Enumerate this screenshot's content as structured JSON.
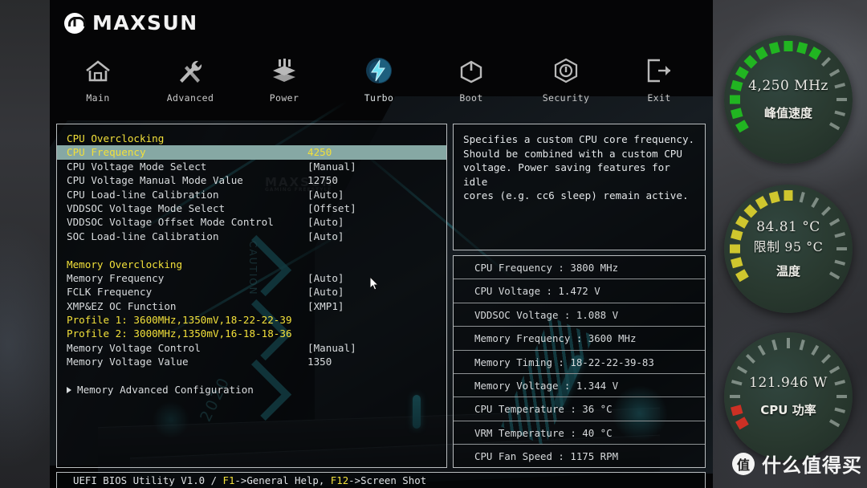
{
  "brand": {
    "name": "MAXSUN",
    "logo_icon": "maxsun-logo-icon"
  },
  "nav": {
    "tabs": [
      {
        "label": "Main",
        "icon": "home-icon",
        "active": false
      },
      {
        "label": "Advanced",
        "icon": "tools-icon",
        "active": false
      },
      {
        "label": "Power",
        "icon": "power-stack-icon",
        "active": false
      },
      {
        "label": "Turbo",
        "icon": "lightning-icon",
        "active": true
      },
      {
        "label": "Boot",
        "icon": "power-icon",
        "active": false
      },
      {
        "label": "Security",
        "icon": "shield-lock-icon",
        "active": false
      },
      {
        "label": "Exit",
        "icon": "exit-icon",
        "active": false
      }
    ]
  },
  "settings": {
    "groups": [
      {
        "header": "CPU Overclocking",
        "rows": [
          {
            "label": "CPU Frequency",
            "value": "4250",
            "selected": true
          },
          {
            "label": "CPU Voltage Mode Select",
            "value": "[Manual]",
            "selected": false
          },
          {
            "label": "CPU Voltage Manual Mode Value",
            "value": "12750",
            "selected": false
          },
          {
            "label": "CPU Load-line Calibration",
            "value": "[Auto]",
            "selected": false
          },
          {
            "label": "VDDSOC Voltage Mode Select",
            "value": "[Offset]",
            "selected": false
          },
          {
            "label": "VDDSOC Voltage Offset Mode Control",
            "value": "[Auto]",
            "selected": false
          },
          {
            "label": "SOC Load-line Calibration",
            "value": "[Auto]",
            "selected": false
          }
        ]
      },
      {
        "header": "Memory Overclocking",
        "rows": [
          {
            "label": "Memory Frequency",
            "value": "[Auto]",
            "selected": false
          },
          {
            "label": "FCLK Frequency",
            "value": "[Auto]",
            "selected": false
          },
          {
            "label": "XMP&EZ OC Function",
            "value": "[XMP1]",
            "selected": false
          },
          {
            "label": "Profile 1: 3600MHz,1350mV,18-22-22-39",
            "value": "",
            "selected": false,
            "profile": true
          },
          {
            "label": "Profile 2: 3000MHz,1350mV,16-18-18-36",
            "value": "",
            "selected": false,
            "profile": true
          },
          {
            "label": "Memory Voltage Control",
            "value": "[Manual]",
            "selected": false
          },
          {
            "label": "Memory Voltage Value",
            "value": "1350",
            "selected": false
          }
        ]
      }
    ],
    "submenu": {
      "label": "Memory Advanced Configuration",
      "icon": "triangle-right-icon"
    }
  },
  "help": {
    "text": "Specifies a custom CPU core frequency.\nShould be combined with a custom CPU\nvoltage. Power saving features for idle\ncores (e.g. cc6 sleep) remain active."
  },
  "status": {
    "rows": [
      {
        "text": "CPU Frequency : 3800 MHz"
      },
      {
        "text": "CPU Voltage : 1.472 V"
      },
      {
        "text": "VDDSOC Voltage : 1.088 V"
      },
      {
        "text": "Memory Frequency : 3600 MHz"
      },
      {
        "text": "Memory Timing : 18-22-22-39-83"
      },
      {
        "text": "Memory Voltage : 1.344 V"
      },
      {
        "text": "CPU Temperature : 36 °C"
      },
      {
        "text": "VRM Temperature : 40 °C"
      },
      {
        "text": "CPU Fan Speed : 1175 RPM"
      }
    ]
  },
  "footer": {
    "prefix": "UEFI BIOS Utility V1.0 / ",
    "key1": "F1",
    "text1": "->General Help, ",
    "key2": "F12",
    "text2": "->Screen Shot"
  },
  "gauges": [
    {
      "id": "peak-speed",
      "line1": "4,250  MHz",
      "line2": "",
      "caption": "峰值速度",
      "color": "#21b521",
      "percent": 62
    },
    {
      "id": "temperature",
      "line1": "84.81 °C",
      "line2": "限制 95 °C",
      "caption": "温度",
      "color": "#cfc62e",
      "percent": 55
    },
    {
      "id": "cpu-power",
      "line1": "121.946 W",
      "line2": "",
      "caption": "CPU 功率",
      "color": "#cc3024",
      "percent": 11
    }
  ],
  "watermark": {
    "badge": "值",
    "text": "什么值得买"
  }
}
